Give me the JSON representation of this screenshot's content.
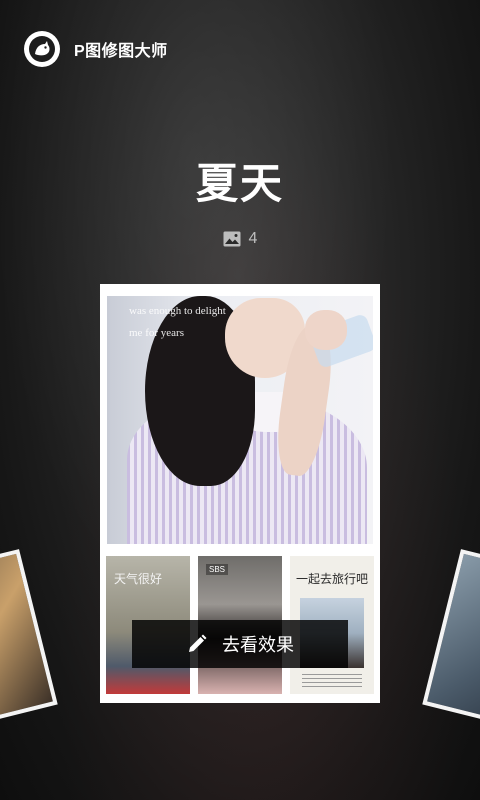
{
  "header": {
    "app_name": "P图修图大师",
    "logo_icon": "cat-logo-icon"
  },
  "album": {
    "title": "夏天",
    "photo_count": "4",
    "count_icon": "image-icon"
  },
  "card": {
    "hero_caption_line1": "was enough to delight",
    "hero_caption_line2": "me for years",
    "thumb1_text": "天气很好",
    "thumb2_badge": "SBS",
    "thumb3_text": "一起去旅行吧"
  },
  "cta": {
    "label": "去看效果",
    "icon": "pencil-icon"
  },
  "colors": {
    "background": "#1e1e1e",
    "card": "#ffffff",
    "cta_background": "#000000"
  }
}
